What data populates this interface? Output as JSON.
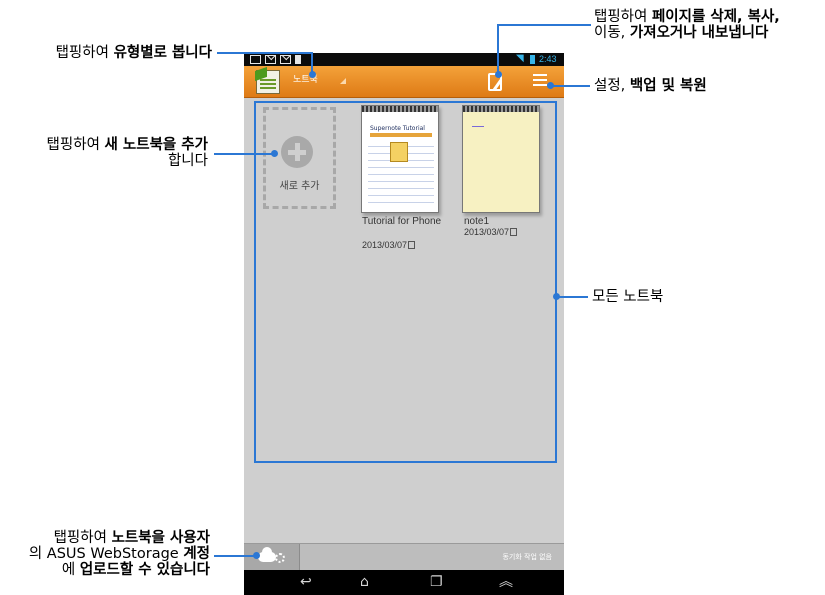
{
  "phone": {
    "status_time": "2:43",
    "action_bar": {
      "title": "노트북"
    },
    "add_tile": {
      "label": "새로 추가"
    },
    "notebooks": [
      {
        "title": "Tutorial for Phone",
        "date": "2013/03/07",
        "cover_title": "Supernote Tutorial"
      },
      {
        "title": "note1",
        "date": "2013/03/07"
      }
    ],
    "bottom": {
      "sync_status": "동기화 작업 없음"
    }
  },
  "callouts": {
    "type_view": {
      "pre": "탭핑하여 ",
      "bold": "유형별로 봅니다"
    },
    "new_notebook": {
      "pre": "탭핑하여 ",
      "bold": "새 노트북을 추가",
      "post": "합니다"
    },
    "upload": {
      "line1_pre": "탭핑하여 ",
      "line1_bold": "노트북을 사용자",
      "line2_pre": "의 ASUS WebStorage ",
      "line2_bold": "계정",
      "line3_pre": "에 ",
      "line3_bold": "업로드할 수 있습니다"
    },
    "page_actions": {
      "line1_pre": "탭핑하여 ",
      "line1_bold": "페이지를 삭제, 복사,",
      "line2_pre": "이동, ",
      "line2_bold": "가져오거나 내보냅니다"
    },
    "settings": {
      "pre": "설정, ",
      "bold": "백업 및 복원"
    },
    "all_notebooks": {
      "text": "모든 노트북"
    }
  },
  "colors": {
    "callout_line": "#2b77d4",
    "action_bar": "#e88a22"
  }
}
